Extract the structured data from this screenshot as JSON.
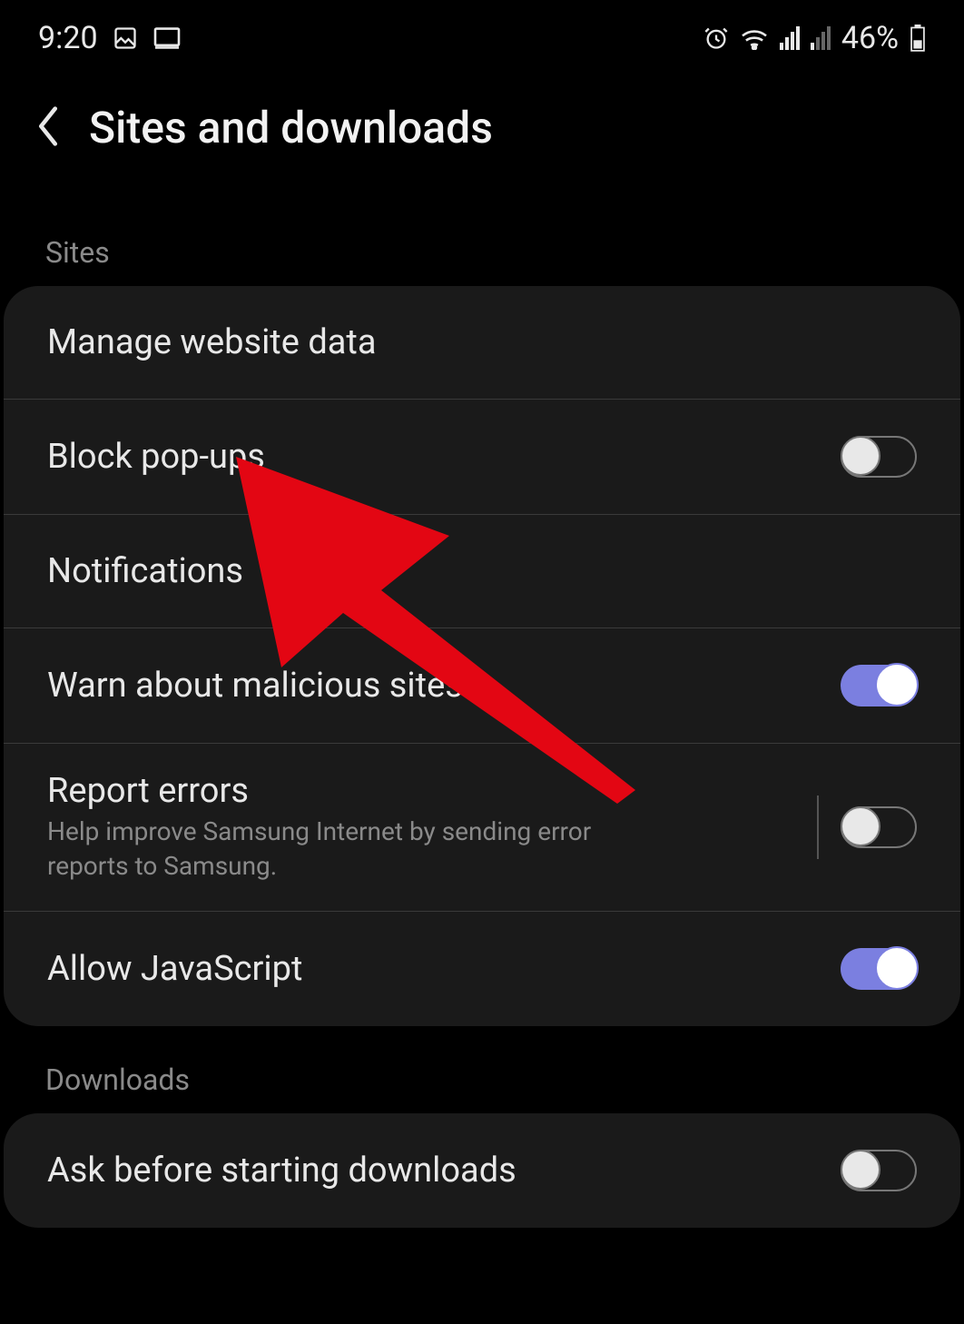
{
  "status_bar": {
    "time": "9:20",
    "battery_pct": "46%"
  },
  "header": {
    "title": "Sites and downloads"
  },
  "sections": {
    "sites": {
      "label": "Sites",
      "items": {
        "manage_data": {
          "title": "Manage website data"
        },
        "block_popups": {
          "title": "Block pop-ups",
          "toggle": "off"
        },
        "notifications": {
          "title": "Notifications"
        },
        "warn_malicious": {
          "title": "Warn about malicious sites",
          "toggle": "on"
        },
        "report_errors": {
          "title": "Report errors",
          "subtitle": "Help improve Samsung Internet by sending error reports to Samsung.",
          "toggle": "off"
        },
        "allow_js": {
          "title": "Allow JavaScript",
          "toggle": "on"
        }
      }
    },
    "downloads": {
      "label": "Downloads",
      "items": {
        "ask_before": {
          "title": "Ask before starting downloads",
          "toggle": "off"
        }
      }
    }
  }
}
